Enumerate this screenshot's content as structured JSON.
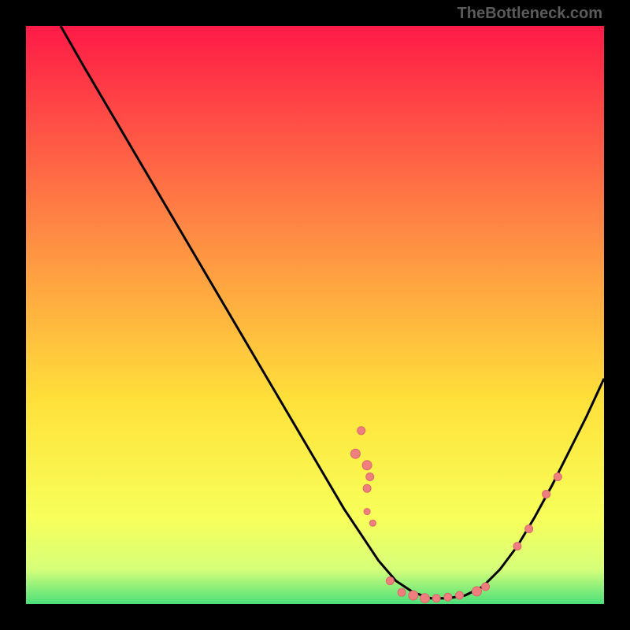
{
  "attribution": "TheBottleneck.com",
  "colors": {
    "top": "#ff1a47",
    "mid1": "#ff8844",
    "mid2": "#ffe13a",
    "mid3": "#f8ff5a",
    "bottom1": "#d6ff7a",
    "bottom2": "#4be07a",
    "scatter_fill": "#ef7e7e",
    "scatter_stroke": "#d86a6a",
    "curve": "#000000"
  },
  "chart_data": {
    "type": "line",
    "title": "",
    "xlabel": "",
    "ylabel": "",
    "xlim": [
      0,
      100
    ],
    "ylim": [
      0,
      100
    ],
    "curve": [
      {
        "x": 6,
        "y": 100
      },
      {
        "x": 10,
        "y": 93
      },
      {
        "x": 15,
        "y": 84.5
      },
      {
        "x": 20,
        "y": 76
      },
      {
        "x": 25,
        "y": 67.5
      },
      {
        "x": 30,
        "y": 59
      },
      {
        "x": 35,
        "y": 50.5
      },
      {
        "x": 40,
        "y": 42
      },
      {
        "x": 45,
        "y": 33.5
      },
      {
        "x": 50,
        "y": 25
      },
      {
        "x": 55,
        "y": 16.5
      },
      {
        "x": 58,
        "y": 12
      },
      {
        "x": 61,
        "y": 7.5
      },
      {
        "x": 64,
        "y": 4
      },
      {
        "x": 67,
        "y": 2
      },
      {
        "x": 70,
        "y": 1
      },
      {
        "x": 73,
        "y": 1
      },
      {
        "x": 76,
        "y": 1.5
      },
      {
        "x": 79,
        "y": 3
      },
      {
        "x": 82,
        "y": 6
      },
      {
        "x": 85,
        "y": 10
      },
      {
        "x": 88,
        "y": 15
      },
      {
        "x": 91,
        "y": 20.5
      },
      {
        "x": 94,
        "y": 26.5
      },
      {
        "x": 97,
        "y": 32.5
      },
      {
        "x": 100,
        "y": 39
      }
    ],
    "scatter": [
      {
        "x": 57,
        "y": 26,
        "r": 6
      },
      {
        "x": 58,
        "y": 30,
        "r": 5
      },
      {
        "x": 59,
        "y": 24,
        "r": 6
      },
      {
        "x": 59.5,
        "y": 22,
        "r": 5
      },
      {
        "x": 59,
        "y": 20,
        "r": 5
      },
      {
        "x": 59,
        "y": 16,
        "r": 4
      },
      {
        "x": 60,
        "y": 14,
        "r": 4
      },
      {
        "x": 63,
        "y": 4,
        "r": 5
      },
      {
        "x": 65,
        "y": 2,
        "r": 5
      },
      {
        "x": 67,
        "y": 1.5,
        "r": 6
      },
      {
        "x": 69,
        "y": 1,
        "r": 6
      },
      {
        "x": 71,
        "y": 1,
        "r": 5
      },
      {
        "x": 73,
        "y": 1.2,
        "r": 5
      },
      {
        "x": 75,
        "y": 1.5,
        "r": 5
      },
      {
        "x": 78,
        "y": 2.2,
        "r": 6
      },
      {
        "x": 79.5,
        "y": 3,
        "r": 5
      },
      {
        "x": 85,
        "y": 10,
        "r": 5
      },
      {
        "x": 87,
        "y": 13,
        "r": 5
      },
      {
        "x": 90,
        "y": 19,
        "r": 5
      },
      {
        "x": 92,
        "y": 22,
        "r": 5
      }
    ]
  }
}
